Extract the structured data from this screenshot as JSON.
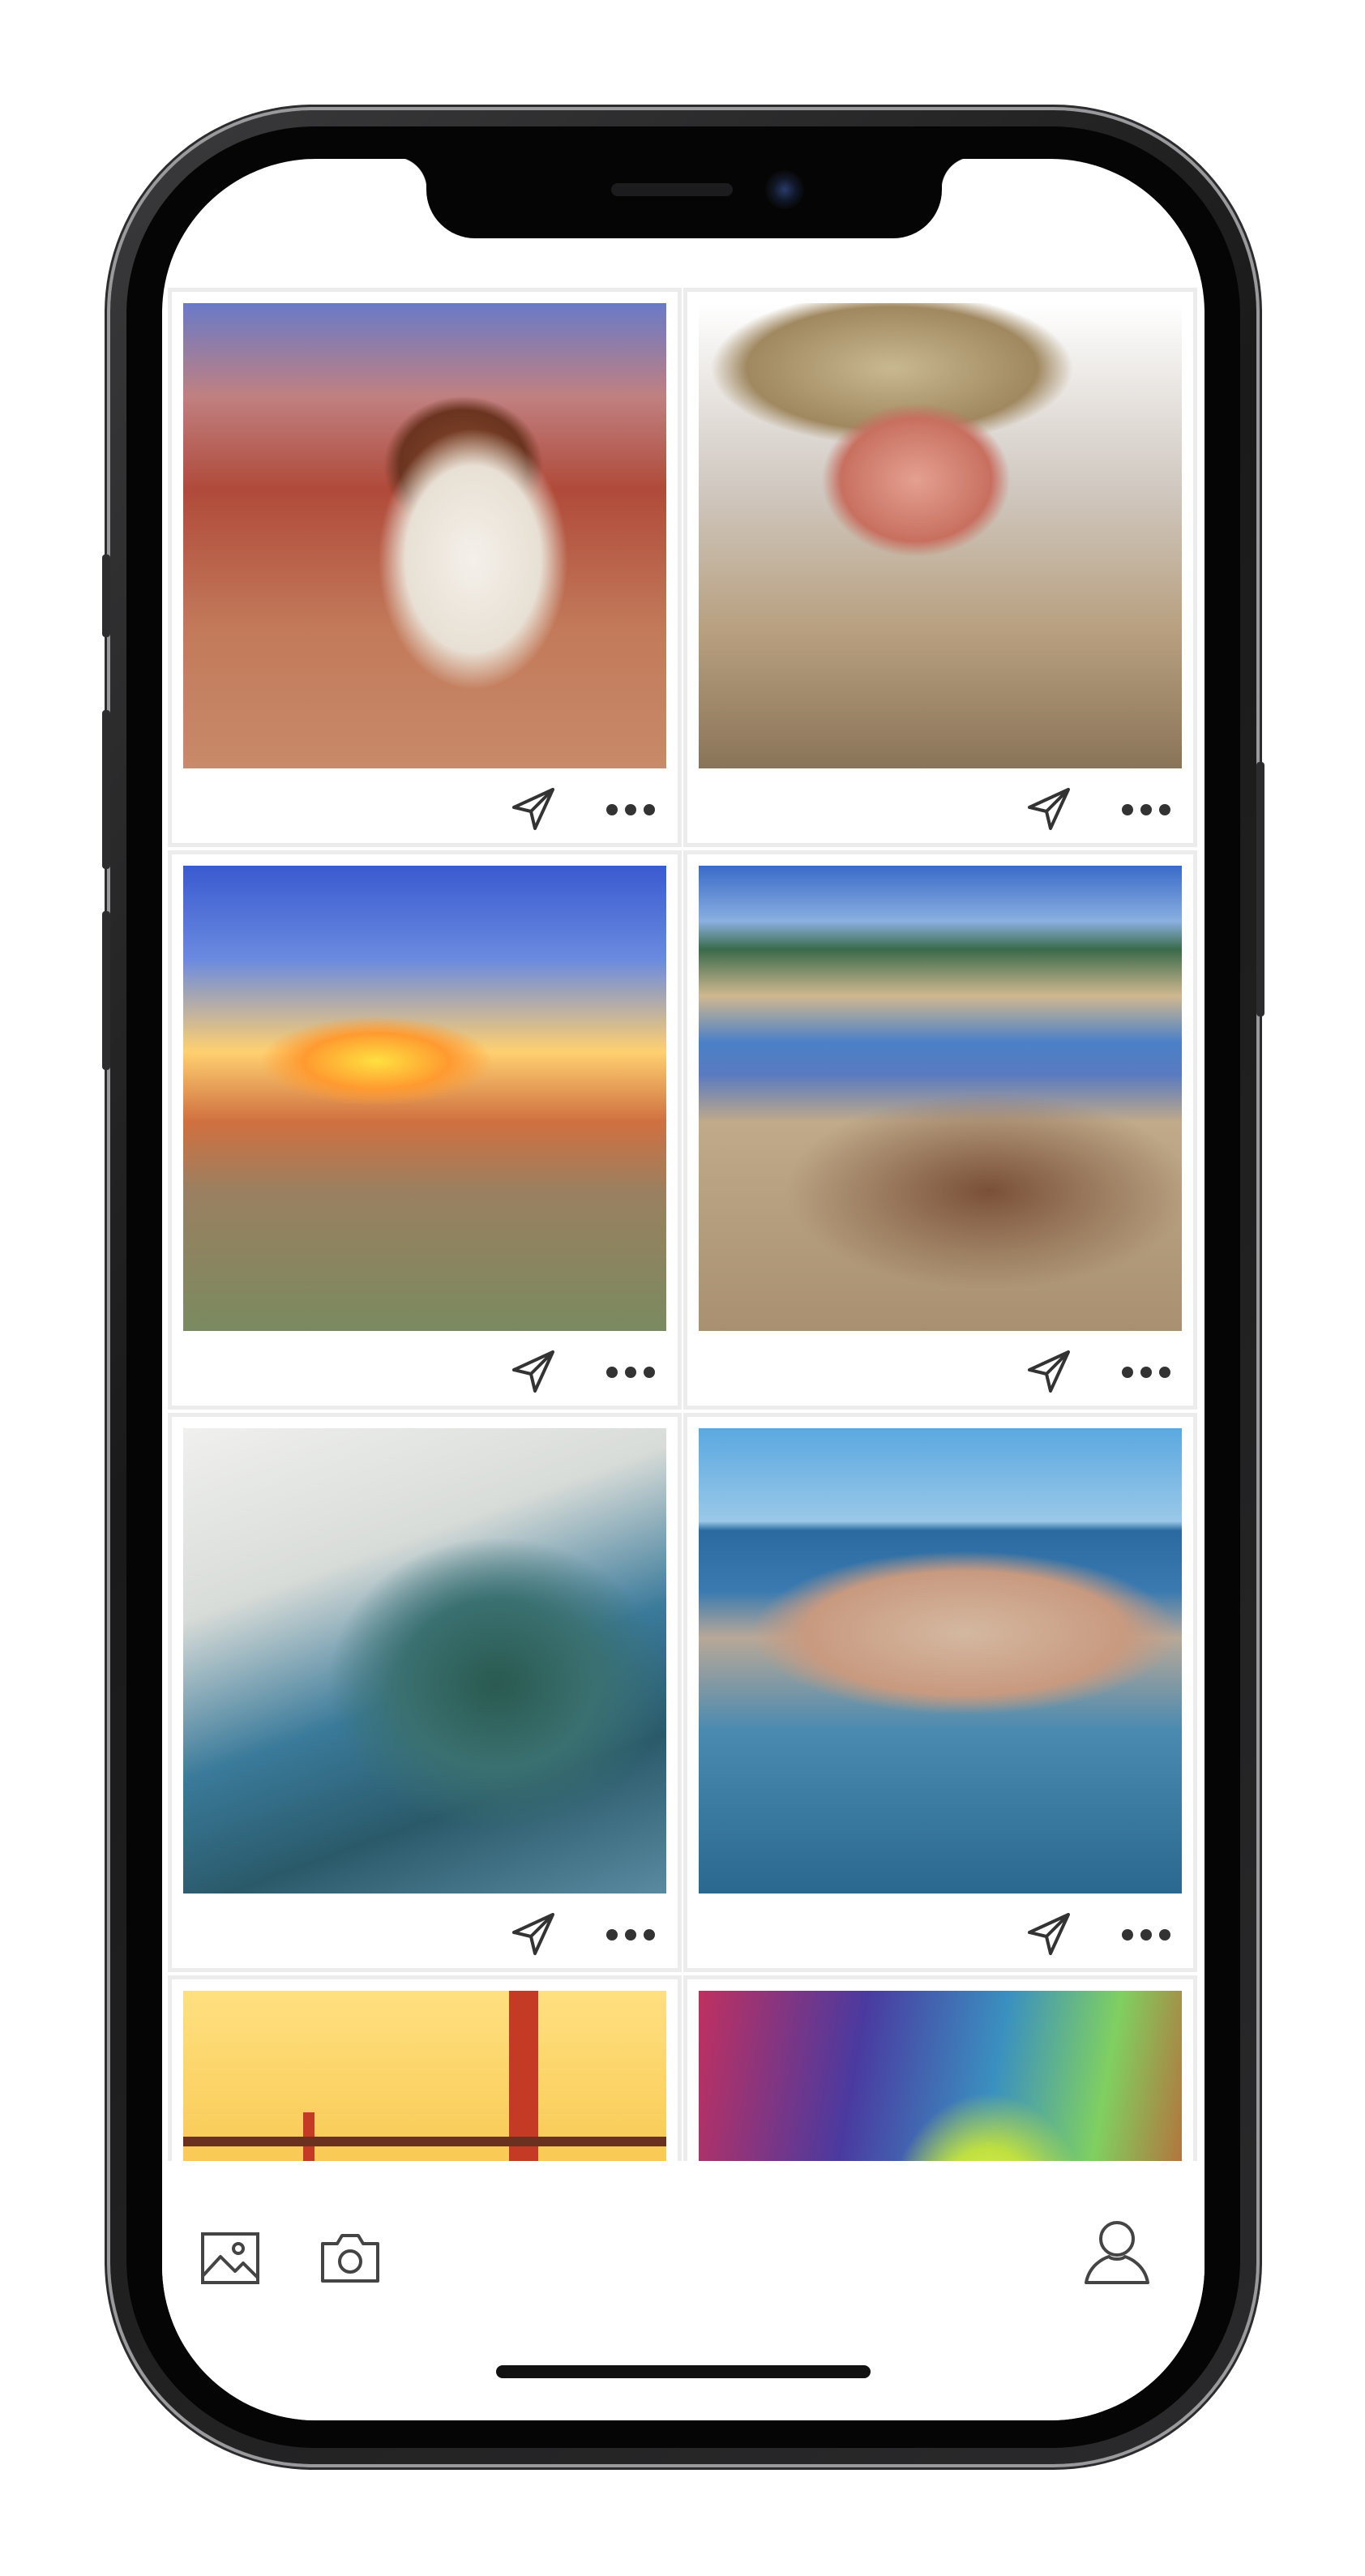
{
  "app": {
    "screen_label": "",
    "accent_color": "#333333"
  },
  "feed": {
    "cards": [
      {
        "artwork": "dog",
        "send_icon": "paper-plane-icon",
        "more_icon": "ellipsis-icon"
      },
      {
        "artwork": "boy-cowboy-hat",
        "send_icon": "paper-plane-icon",
        "more_icon": "ellipsis-icon"
      },
      {
        "artwork": "desert-saguaro-sunset",
        "send_icon": "paper-plane-icon",
        "more_icon": "ellipsis-icon"
      },
      {
        "artwork": "bison-herd-river",
        "send_icon": "paper-plane-icon",
        "more_icon": "ellipsis-icon"
      },
      {
        "artwork": "ocean-wave-surfer",
        "send_icon": "paper-plane-icon",
        "more_icon": "ellipsis-icon"
      },
      {
        "artwork": "coastal-walled-city",
        "send_icon": "paper-plane-icon",
        "more_icon": "ellipsis-icon"
      },
      {
        "artwork": "golden-gate-bridge",
        "send_icon": "paper-plane-icon",
        "more_icon": "ellipsis-icon"
      },
      {
        "artwork": "aurora-sky",
        "send_icon": "paper-plane-icon",
        "more_icon": "ellipsis-icon"
      }
    ]
  },
  "tabbar": {
    "gallery_icon": "gallery-icon",
    "camera_icon": "camera-icon",
    "profile_icon": "profile-icon"
  }
}
